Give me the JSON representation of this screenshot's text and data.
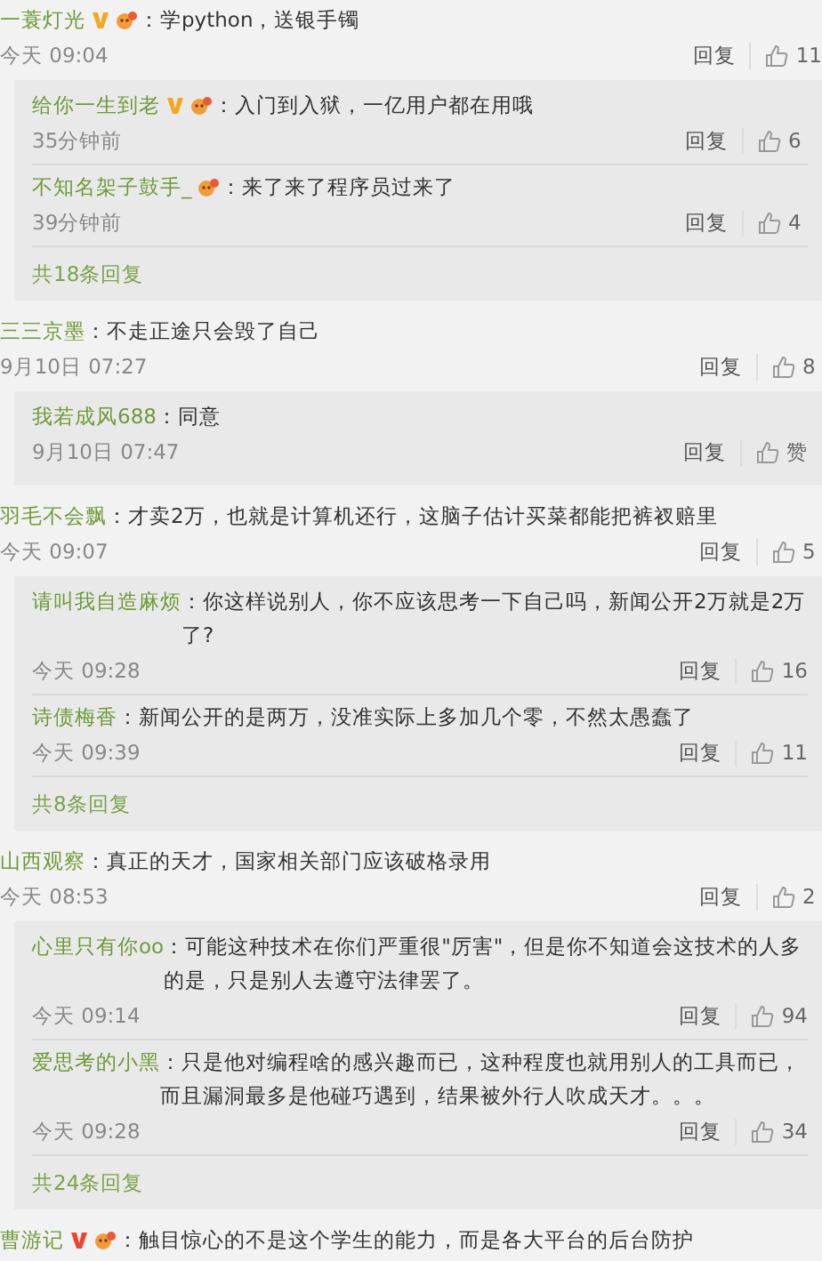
{
  "comments": [
    {
      "name": "一蓑灯光",
      "color": "#f5a623",
      "fan": true,
      "text": "：学python，送银手镯",
      "time": "今天 09:04",
      "reply_label": "回复",
      "likes": "11",
      "replies": [
        {
          "name": "给你一生到老",
          "color": "#f5a623",
          "fan": true,
          "text": "：入门到入狱，一亿用户都在用哦",
          "time": "35分钟前",
          "reply_label": "回复",
          "likes": "6"
        },
        {
          "name": "不知名架子鼓手_",
          "fan": true,
          "text": "：来了来了程序员过来了",
          "time": "39分钟前",
          "reply_label": "回复",
          "likes": "4"
        }
      ],
      "more": "共18条回复"
    },
    {
      "name": "三三京墨",
      "text": "：不走正途只会毁了自己",
      "time": "9月10日 07:27",
      "reply_label": "回复",
      "likes": "8",
      "replies": [
        {
          "name": "我若成风688",
          "text": "：同意",
          "time": "9月10日 07:47",
          "reply_label": "回复",
          "likes": "赞"
        }
      ]
    },
    {
      "name": "羽毛不会飘",
      "text": "：才卖2万，也就是计算机还行，这脑子估计买菜都能把裤衩赔里",
      "time": "今天 09:07",
      "reply_label": "回复",
      "likes": "5",
      "replies": [
        {
          "name": "请叫我自造麻烦",
          "text": "：你这样说别人，你不应该思考一下自己吗，新闻公开2万就是2万了?",
          "time": "今天 09:28",
          "reply_label": "回复",
          "likes": "16"
        },
        {
          "name": "诗债梅香",
          "text": "：新闻公开的是两万，没准实际上多加几个零，不然太愚蠢了",
          "time": "今天 09:39",
          "reply_label": "回复",
          "likes": "11"
        }
      ],
      "more": "共8条回复"
    },
    {
      "name": "山西观察",
      "text": "：真正的天才，国家相关部门应该破格录用",
      "time": "今天 08:53",
      "reply_label": "回复",
      "likes": "2",
      "replies": [
        {
          "name": "心里只有你oo",
          "text": "：可能这种技术在你们严重很\"厉害\"，但是你不知道会这技术的人多的是，只是别人去遵守法律罢了。",
          "time": "今天 09:14",
          "reply_label": "回复",
          "likes": "94"
        },
        {
          "name": "爱思考的小黑",
          "text": "：只是他对编程啥的感兴趣而已，这种程度也就用别人的工具而已，而且漏洞最多是他碰巧遇到，结果被外行人吹成天才。。。",
          "time": "今天 09:28",
          "reply_label": "回复",
          "likes": "34"
        }
      ],
      "more": "共24条回复"
    },
    {
      "name": "曹游记",
      "color": "#e8462e",
      "fan": true,
      "text": "：触目惊心的不是这个学生的能力，而是各大平台的后台防护"
    }
  ]
}
